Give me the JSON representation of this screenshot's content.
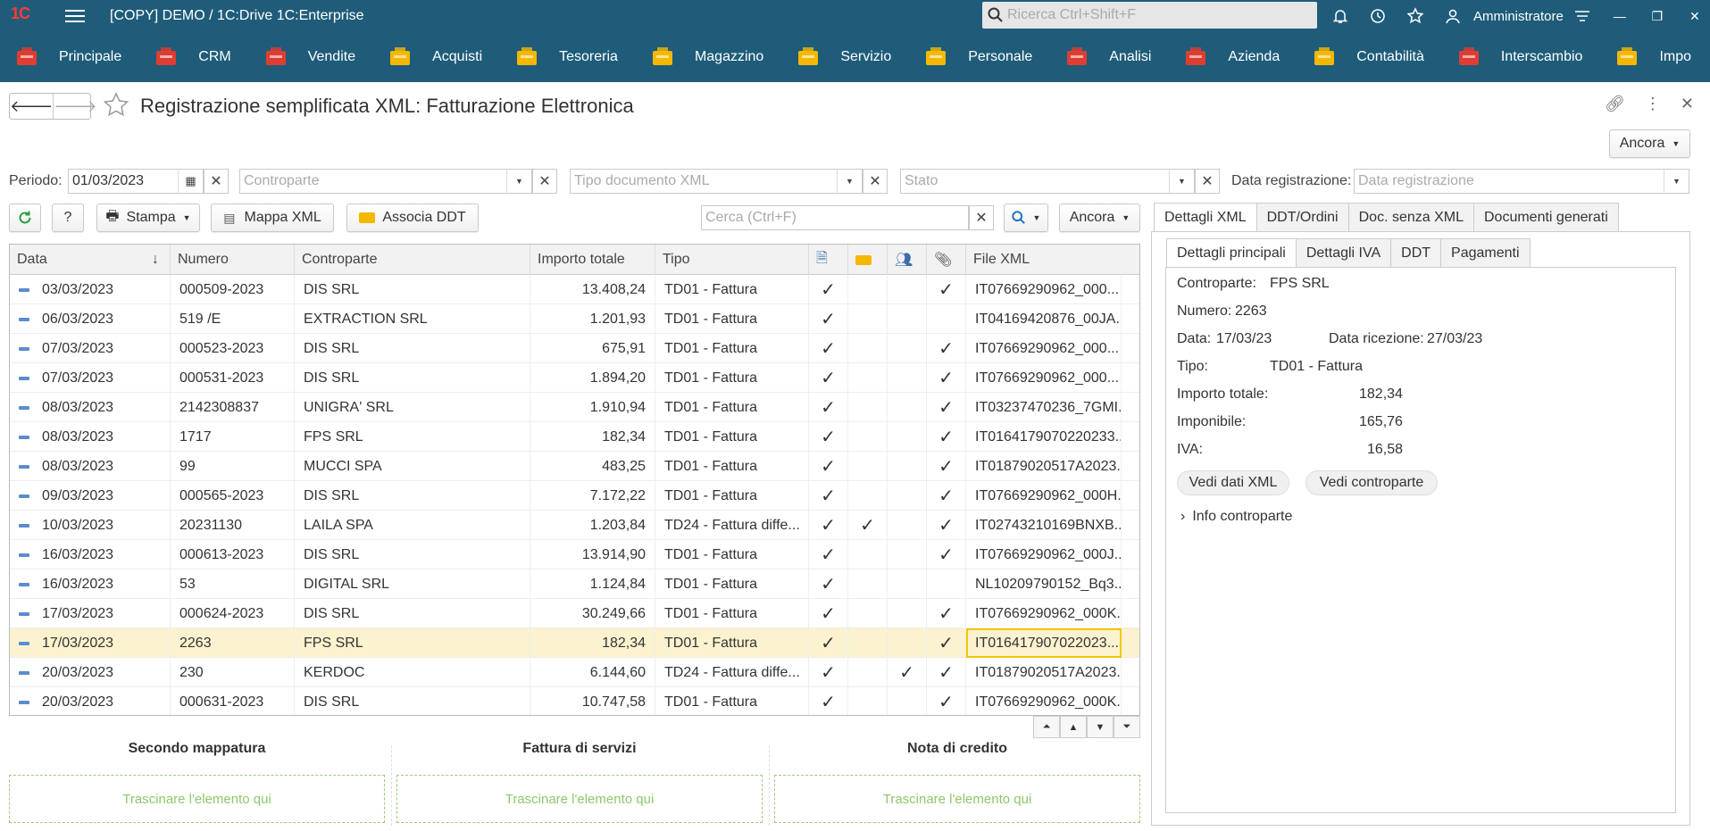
{
  "app": {
    "title": "[COPY] DEMO / 1C:Drive 1C:Enterprise",
    "search_placeholder": "Ricerca Ctrl+Shift+F",
    "user": "Amministratore",
    "logo": "1С"
  },
  "sections": [
    {
      "label": "Principale",
      "icon": "home-icon",
      "color": "#e03c31"
    },
    {
      "label": "CRM",
      "icon": "crm-icon",
      "color": "#e03c31"
    },
    {
      "label": "Vendite",
      "icon": "cart-icon",
      "color": "#e03c31"
    },
    {
      "label": "Acquisti",
      "icon": "truck-icon",
      "color": "#f5b800"
    },
    {
      "label": "Tesoreria",
      "icon": "treasury-icon",
      "color": "#f5b800"
    },
    {
      "label": "Magazzino",
      "icon": "box-icon",
      "color": "#f5b800"
    },
    {
      "label": "Servizio",
      "icon": "service-icon",
      "color": "#f5b800"
    },
    {
      "label": "Personale",
      "icon": "people-icon",
      "color": "#f5b800"
    },
    {
      "label": "Analisi",
      "icon": "chart-icon",
      "color": "#e03c31"
    },
    {
      "label": "Azienda",
      "icon": "company-icon",
      "color": "#e03c31"
    },
    {
      "label": "Contabilità",
      "icon": "ledger-icon",
      "color": "#f5b800"
    },
    {
      "label": "Interscambio",
      "icon": "exchange-icon",
      "color": "#e03c31"
    },
    {
      "label": "Impo",
      "icon": "import-icon",
      "color": "#f5b800"
    }
  ],
  "form": {
    "title": "Registrazione semplificata XML: Fatturazione Elettronica",
    "more_button": "Ancora"
  },
  "filters": {
    "periodo_label": "Periodo:",
    "periodo_value": "01/03/2023",
    "controparte_placeholder": "Controparte",
    "tipo_placeholder": "Tipo documento XML",
    "stato_placeholder": "Stato",
    "data_reg_label": "Data registrazione:",
    "data_reg_placeholder": "Data registrazione"
  },
  "toolbar": {
    "help": "?",
    "print": "Stampa",
    "map": "Mappa XML",
    "assoc": "Associa DDT",
    "search_placeholder": "Cerca (Ctrl+F)",
    "more": "Ancora"
  },
  "table": {
    "headers": [
      "Data",
      "Numero",
      "Controparte",
      "Importo totale",
      "Tipo",
      "",
      "",
      "",
      "",
      "File XML"
    ],
    "rows": [
      {
        "data": "03/03/2023",
        "numero": "000509-2023",
        "controparte": "DIS SRL",
        "importo": "13.408,24",
        "tipo": "TD01 - Fattura",
        "c1": "✓",
        "c2": "",
        "c3": "",
        "c4": "✓",
        "file": "IT07669290962_000..."
      },
      {
        "data": "06/03/2023",
        "numero": "519 /E",
        "controparte": "EXTRACTION SRL",
        "importo": "1.201,93",
        "tipo": "TD01 - Fattura",
        "c1": "✓",
        "c2": "",
        "c3": "",
        "c4": "",
        "file": "IT04169420876_00JA..."
      },
      {
        "data": "07/03/2023",
        "numero": "000523-2023",
        "controparte": "DIS SRL",
        "importo": "675,91",
        "tipo": "TD01 - Fattura",
        "c1": "✓",
        "c2": "",
        "c3": "",
        "c4": "✓",
        "file": "IT07669290962_000..."
      },
      {
        "data": "07/03/2023",
        "numero": "000531-2023",
        "controparte": "DIS SRL",
        "importo": "1.894,20",
        "tipo": "TD01 - Fattura",
        "c1": "✓",
        "c2": "",
        "c3": "",
        "c4": "✓",
        "file": "IT07669290962_000..."
      },
      {
        "data": "08/03/2023",
        "numero": "2142308837",
        "controparte": "UNIGRA' SRL",
        "importo": "1.910,94",
        "tipo": "TD01 - Fattura",
        "c1": "✓",
        "c2": "",
        "c3": "",
        "c4": "✓",
        "file": "IT03237470236_7GMI..."
      },
      {
        "data": "08/03/2023",
        "numero": "1717",
        "controparte": "FPS SRL",
        "importo": "182,34",
        "tipo": "TD01 - Fattura",
        "c1": "✓",
        "c2": "",
        "c3": "",
        "c4": "✓",
        "file": "IT0164179070220233..."
      },
      {
        "data": "08/03/2023",
        "numero": "99",
        "controparte": "MUCCI SPA",
        "importo": "483,25",
        "tipo": "TD01 - Fattura",
        "c1": "✓",
        "c2": "",
        "c3": "",
        "c4": "✓",
        "file": "IT01879020517A2023..."
      },
      {
        "data": "09/03/2023",
        "numero": "000565-2023",
        "controparte": "DIS SRL",
        "importo": "7.172,22",
        "tipo": "TD01 - Fattura",
        "c1": "✓",
        "c2": "",
        "c3": "",
        "c4": "✓",
        "file": "IT07669290962_000H..."
      },
      {
        "data": "10/03/2023",
        "numero": "20231130",
        "controparte": "LAILA SPA",
        "importo": "1.203,84",
        "tipo": "TD24 - Fattura diffe...",
        "c1": "✓",
        "c2": "✓",
        "c3": "",
        "c4": "✓",
        "file": "IT02743210169BNXB..."
      },
      {
        "data": "16/03/2023",
        "numero": "000613-2023",
        "controparte": "DIS SRL",
        "importo": "13.914,90",
        "tipo": "TD01 - Fattura",
        "c1": "✓",
        "c2": "",
        "c3": "",
        "c4": "✓",
        "file": "IT07669290962_000J..."
      },
      {
        "data": "16/03/2023",
        "numero": "53",
        "controparte": "DIGITAL SRL",
        "importo": "1.124,84",
        "tipo": "TD01 - Fattura",
        "c1": "✓",
        "c2": "",
        "c3": "",
        "c4": "",
        "file": "NL10209790152_Bq3..."
      },
      {
        "data": "17/03/2023",
        "numero": "000624-2023",
        "controparte": "DIS SRL",
        "importo": "30.249,66",
        "tipo": "TD01 - Fattura",
        "c1": "✓",
        "c2": "",
        "c3": "",
        "c4": "✓",
        "file": "IT07669290962_000K..."
      },
      {
        "data": "17/03/2023",
        "numero": "2263",
        "controparte": "FPS SRL",
        "importo": "182,34",
        "tipo": "TD01 - Fattura",
        "c1": "✓",
        "c2": "",
        "c3": "",
        "c4": "✓",
        "file": "IT016417907022023..."
      },
      {
        "data": "20/03/2023",
        "numero": "230",
        "controparte": "KERDOC",
        "importo": "6.144,60",
        "tipo": "TD24 - Fattura diffe...",
        "c1": "✓",
        "c2": "",
        "c3": "✓",
        "c4": "✓",
        "file": "IT01879020517A2023..."
      },
      {
        "data": "20/03/2023",
        "numero": "000631-2023",
        "controparte": "DIS SRL",
        "importo": "10.747,58",
        "tipo": "TD01 - Fattura",
        "c1": "✓",
        "c2": "",
        "c3": "",
        "c4": "✓",
        "file": "IT07669290962_000K..."
      }
    ]
  },
  "dropzones": [
    {
      "title": "Secondo mappatura",
      "hint": "Trascinare l'elemento qui"
    },
    {
      "title": "Fattura di servizi",
      "hint": "Trascinare l'elemento qui"
    },
    {
      "title": "Nota di credito",
      "hint": "Trascinare l'elemento qui"
    }
  ],
  "right": {
    "tabs": [
      "Dettagli XML",
      "DDT/Ordini",
      "Doc. senza XML",
      "Documenti generati"
    ],
    "subtabs": [
      "Dettagli principali",
      "Dettagli IVA",
      "DDT",
      "Pagamenti"
    ],
    "controparte_k": "Controparte:",
    "controparte_v": "FPS SRL",
    "numero_k": "Numero:",
    "numero_v": "2263",
    "data_k": "Data:",
    "data_v": "17/03/23",
    "ricezione_k": "Data ricezione:",
    "ricezione_v": "27/03/23",
    "tipo_k": "Tipo:",
    "tipo_v": "TD01 - Fattura",
    "importo_k": "Importo totale:",
    "importo_v": "182,34",
    "imponibile_k": "Imponibile:",
    "imponibile_v": "165,76",
    "iva_k": "IVA:",
    "iva_v": "16,58",
    "btn_xml": "Vedi dati XML",
    "btn_contro": "Vedi controparte",
    "info": "Info controparte"
  }
}
